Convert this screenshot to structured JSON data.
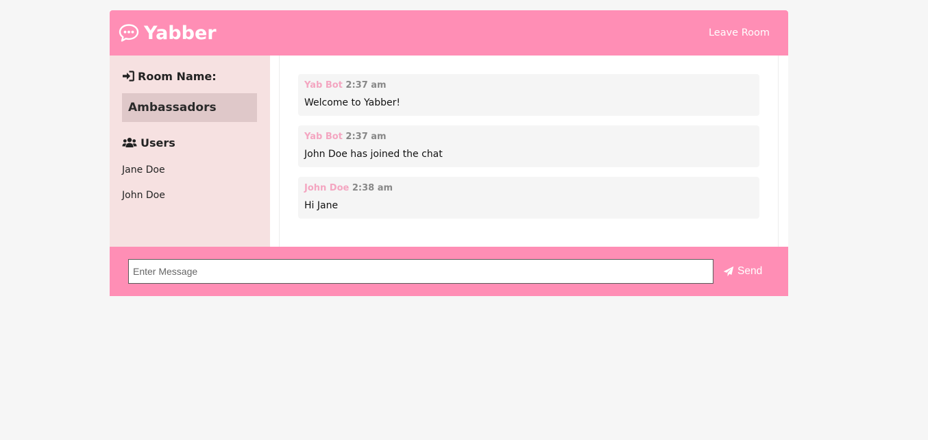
{
  "header": {
    "title": "Yabber",
    "leave_label": "Leave Room",
    "color": "#ff8eb5"
  },
  "sidebar": {
    "room_heading": "Room Name:",
    "room_name": "Ambassadors",
    "users_heading": "Users",
    "users": [
      "Jane Doe",
      "John Doe"
    ],
    "background": "#f6e1e1"
  },
  "messages": [
    {
      "author": "Yab Bot",
      "time": "2:37 am",
      "text": "Welcome to Yabber!"
    },
    {
      "author": "Yab Bot",
      "time": "2:37 am",
      "text": "John Doe has joined the chat"
    },
    {
      "author": "John Doe",
      "time": "2:38 am",
      "text": "Hi Jane"
    }
  ],
  "form": {
    "placeholder": "Enter Message",
    "value": "",
    "send_label": "Send"
  },
  "icons": {
    "brand": "chat-bubble-icon",
    "room": "sign-in-icon",
    "users": "users-icon",
    "send": "paper-plane-icon"
  },
  "colors": {
    "author": "#f4a6c1",
    "time": "#888888"
  }
}
